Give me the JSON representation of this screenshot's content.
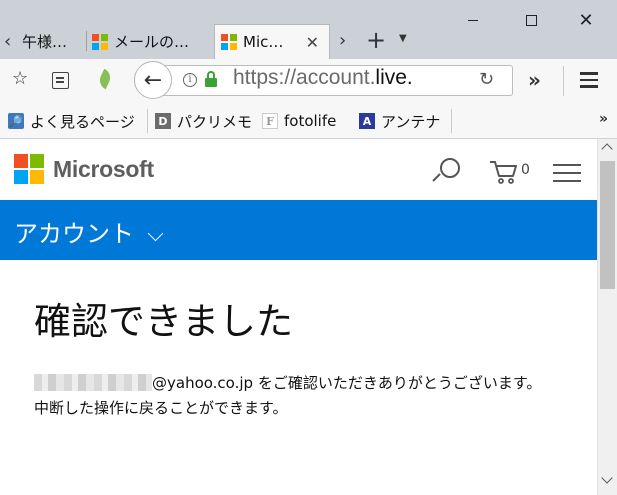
{
  "browser": {
    "tabs": [
      {
        "label": "午様…",
        "icon": "generic-page-icon"
      },
      {
        "label": "メールの…",
        "icon": "microsoft-logo-icon"
      },
      {
        "label": "Mic…",
        "icon": "microsoft-logo-icon",
        "active": true
      }
    ],
    "url": {
      "scheme_prefix": "https://account.",
      "domain": "live.",
      "secure": true
    },
    "bookmarks": [
      {
        "label": "よく見るページ",
        "icon_glyph": "🔎"
      },
      {
        "label": "パクリメモ",
        "icon_glyph": "D"
      },
      {
        "label": "fotolife",
        "icon_glyph": "F"
      },
      {
        "label": "アンテナ",
        "icon_glyph": "A"
      }
    ],
    "overflow_glyph": "»"
  },
  "ms_logo_colors": [
    "#f25022",
    "#7fba00",
    "#00a4ef",
    "#ffb900"
  ],
  "site": {
    "brand": "Microsoft",
    "cart_count": "0",
    "account_bar": {
      "title": "アカウント",
      "color": "#0078d7"
    }
  },
  "main": {
    "title": "確認できました",
    "message_line1_suffix": "@yahoo.co.jp をご確認いただきありがとうございます。",
    "message_line2": "中断した操作に戻ることができます。"
  }
}
